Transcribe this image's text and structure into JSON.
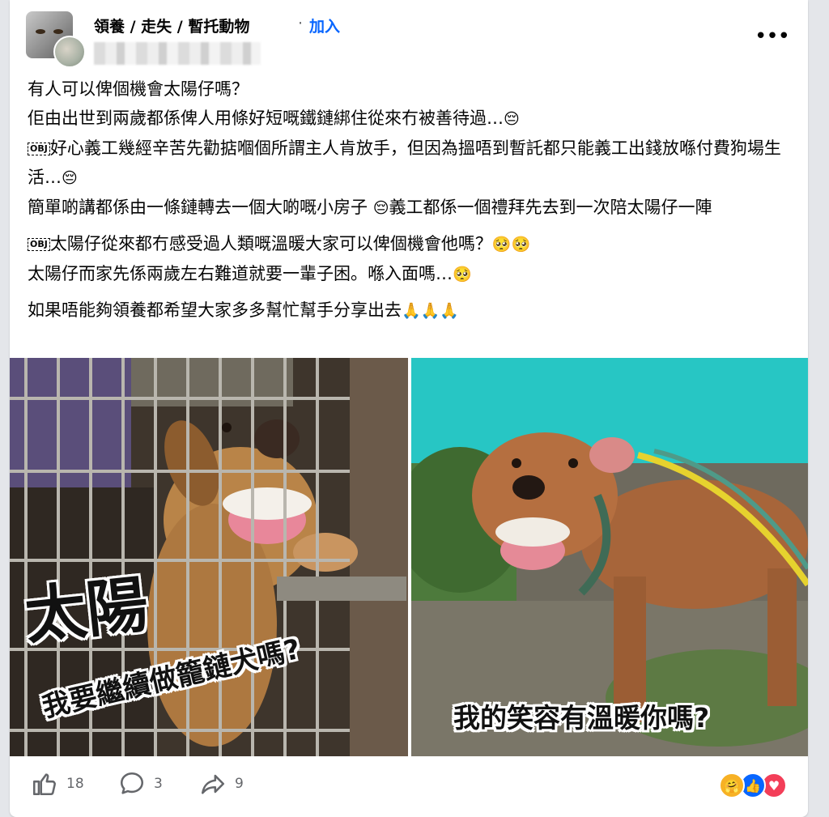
{
  "header": {
    "group_name": "領養 / 走失 / 暫托動物",
    "separator": "·",
    "join_label": "加入",
    "more_label": "•••"
  },
  "post": {
    "line1": "有人可以俾個機會太陽仔嗎？",
    "line2": "佢由出世到兩歲都係俾人用條好短嘅鐵鏈綁住從來冇被善待過…",
    "obj_mark": "OBJ",
    "line3": "好心義工幾經辛苦先勸掂嗰個所謂主人肯放手，但因為搵唔到暫託都只能義工出錢放喺付費狗場生活…",
    "line4a": "簡單啲講都係由一條鏈轉去一個大啲嘅小房子",
    "line4b": "義工都係一個禮拜先去到一次陪太陽仔一陣",
    "line5": "太陽仔從來都冇感受過人類嘅溫暖大家可以俾個機會他嗎？",
    "line6": "太陽仔而家先係兩歲左右難道就要一輩子困。喺入面嗎…",
    "line7": "如果唔能夠領養都希望大家多多幫忙幫手分享出去",
    "emoji_sad": "😔",
    "emoji_plead": "🥺",
    "emoji_pray": "🙏🙏🙏"
  },
  "images": {
    "left_caption_big": "太陽",
    "left_caption": "我要繼續做籠鏈犬嗎?",
    "right_caption": "我的笑容有溫暖你嗎?"
  },
  "footer": {
    "likes": "18",
    "comments": "3",
    "shares": "9",
    "reaction_icons": [
      "care-icon",
      "like-icon",
      "love-icon"
    ],
    "colors": {
      "like": "#0866ff",
      "love": "#f33e58",
      "care": "#f7b125"
    }
  }
}
